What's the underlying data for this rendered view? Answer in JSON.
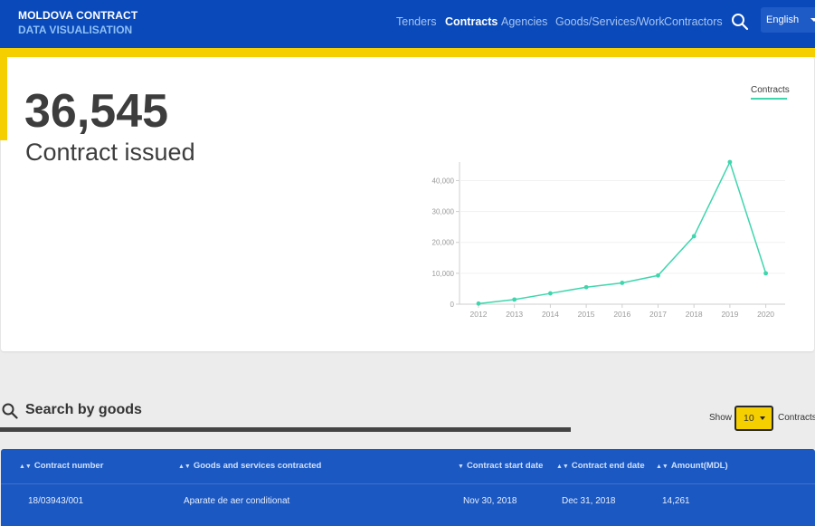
{
  "header": {
    "brand_line1": "MOLDOVA CONTRACT",
    "brand_line2": "DATA VISUALISATION",
    "nav": [
      "Tenders",
      "Contracts",
      "Agencies",
      "Goods/Services/Work",
      "Contractors"
    ],
    "active_nav": "Contracts",
    "language": "English"
  },
  "summary": {
    "count": "36,545",
    "label": "Contract issued",
    "chart_tab": "Contracts"
  },
  "chart_data": {
    "type": "line",
    "x": [
      "2012",
      "2013",
      "2014",
      "2015",
      "2016",
      "2017",
      "2018",
      "2019",
      "2020"
    ],
    "y": [
      200,
      1500,
      3500,
      5500,
      6900,
      9300,
      22000,
      46000,
      10000
    ],
    "y_ticks": [
      "0",
      "10,000",
      "20,000",
      "30,000",
      "40,000"
    ],
    "ylim": [
      0,
      46000
    ],
    "color": "#3fd6ad",
    "grid": true
  },
  "search": {
    "title": "Search by goods",
    "show_label": "Show",
    "page_size": "10",
    "suffix_label": "Contracts"
  },
  "table": {
    "headers": [
      "Contract number",
      "Goods and services contracted",
      "Contract start date",
      "Contract end date",
      "Amount(MDL)"
    ],
    "rows": [
      [
        "18/03943/001",
        "Aparate de aer conditionat",
        "Nov 30, 2018",
        "Dec 31, 2018",
        "14,261"
      ]
    ]
  }
}
